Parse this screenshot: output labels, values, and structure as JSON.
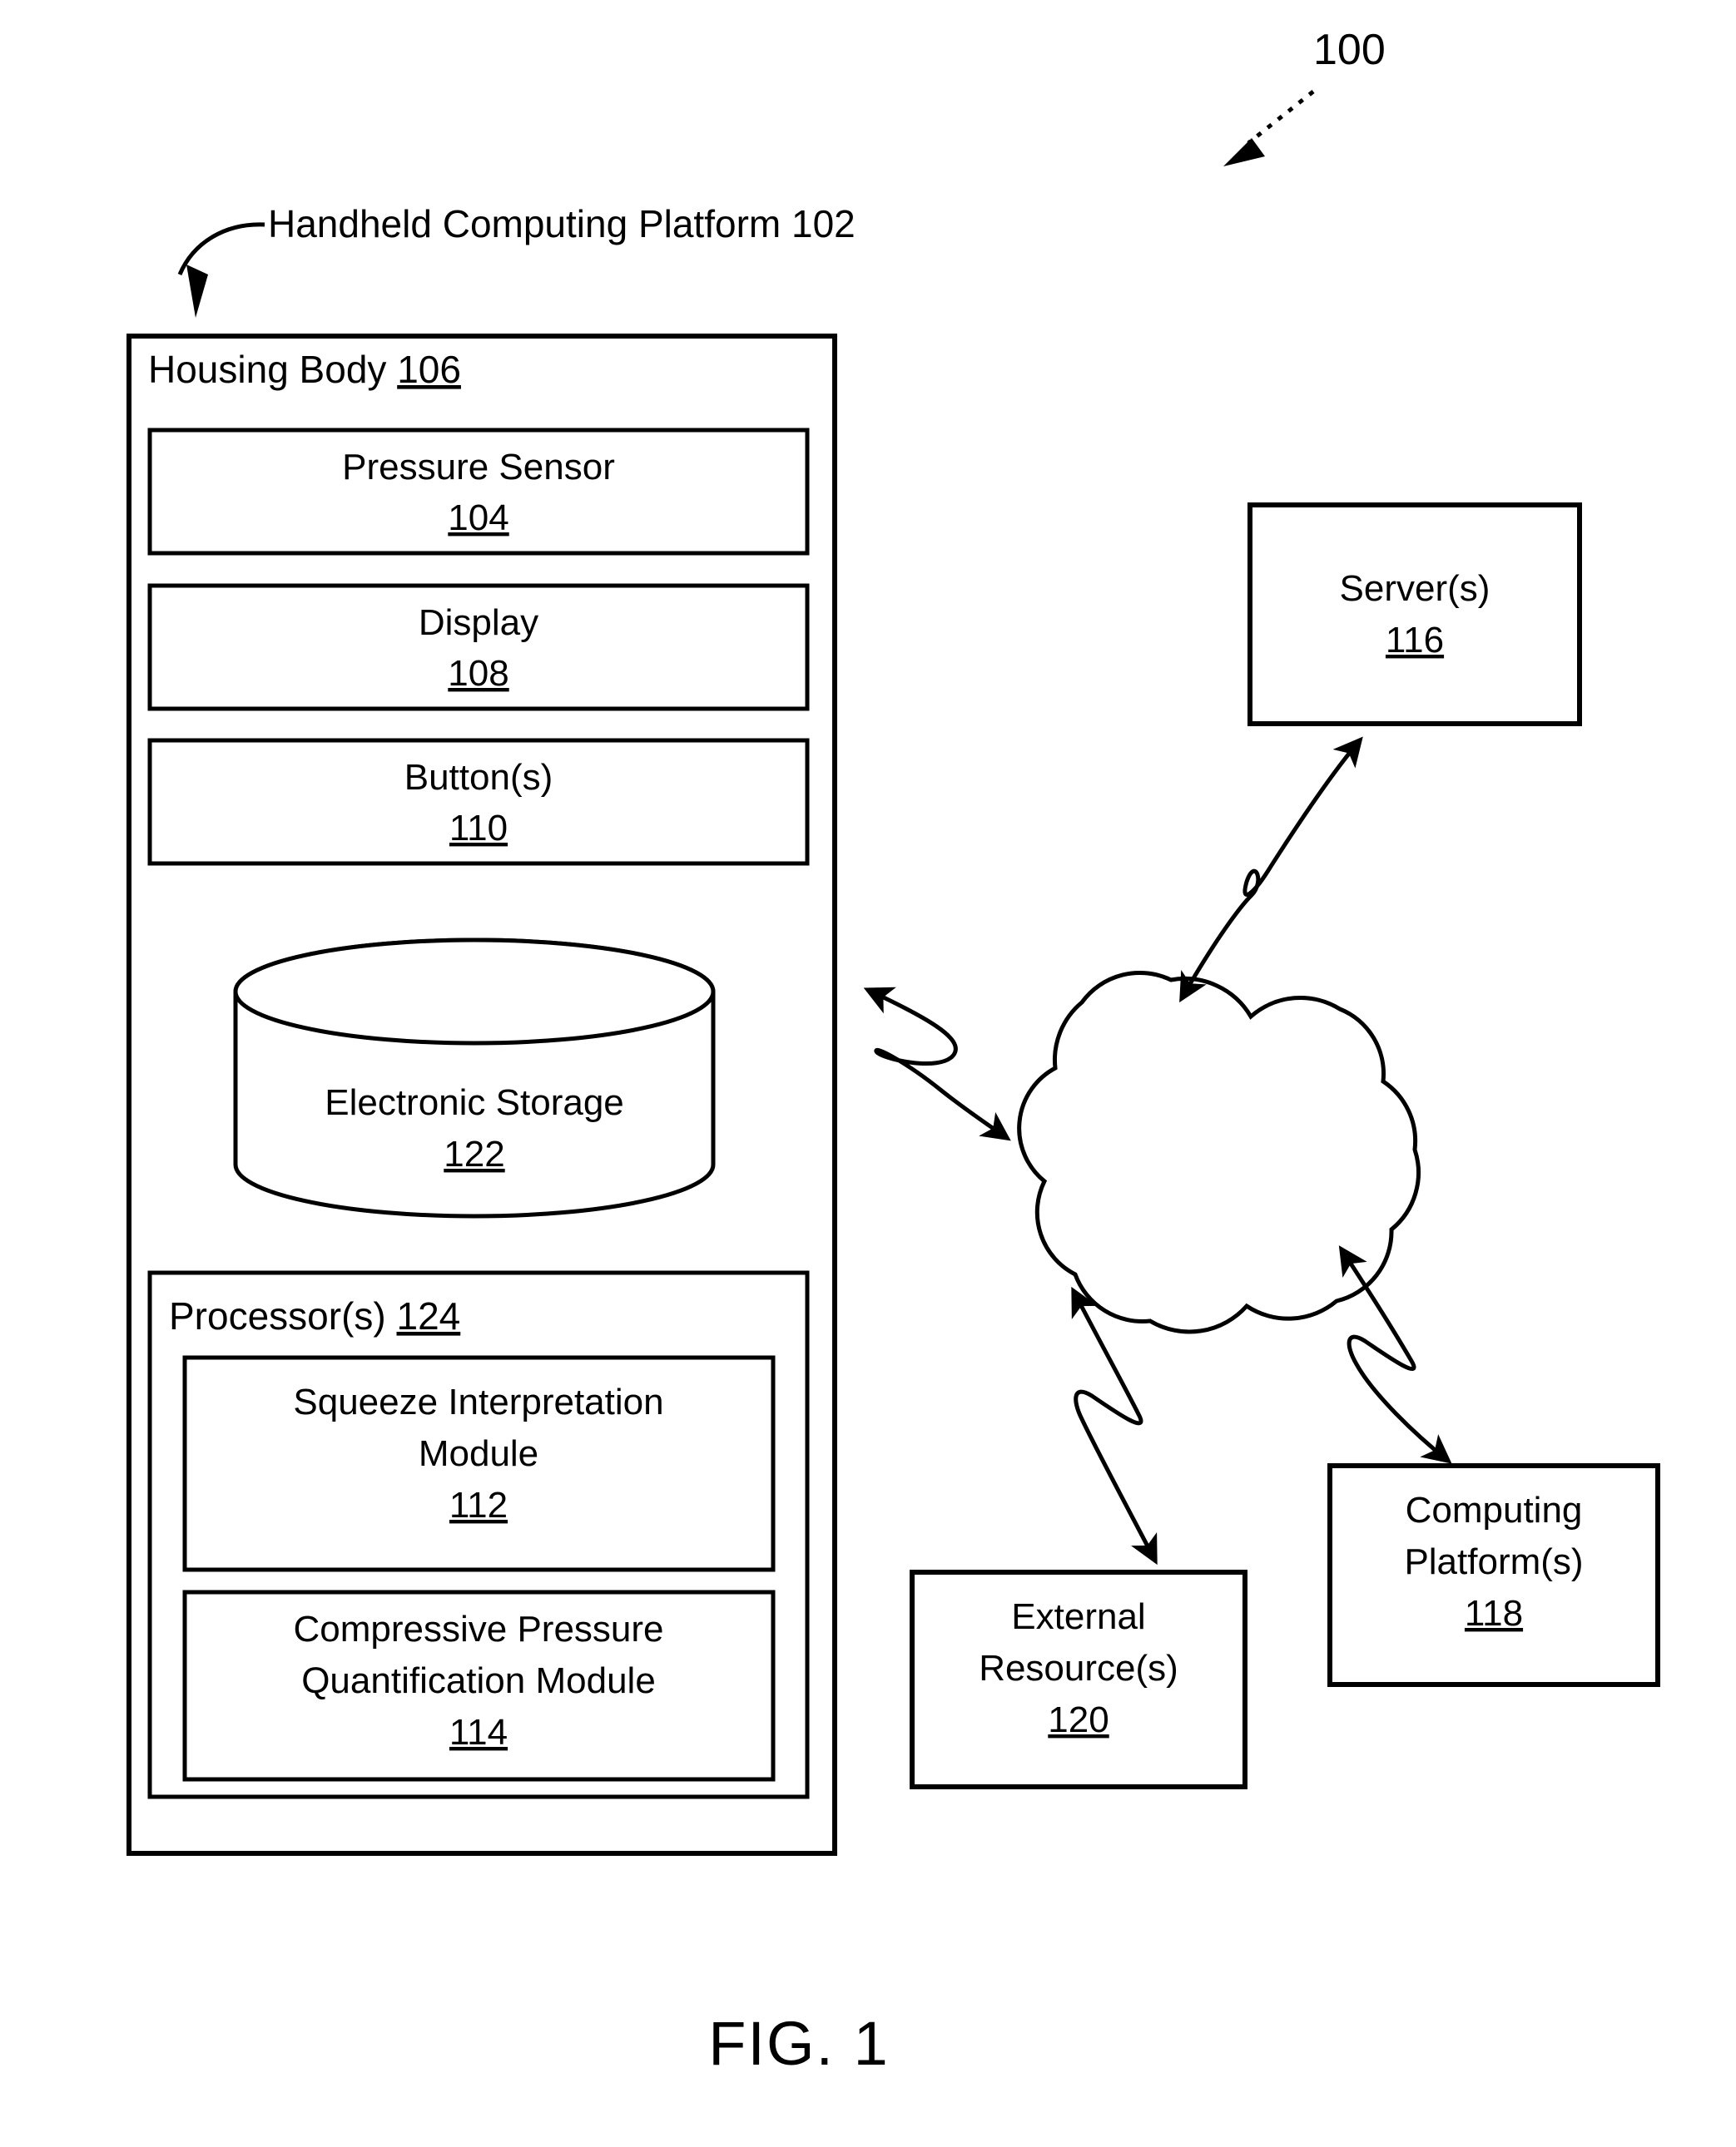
{
  "figure": {
    "caption": "FIG. 1",
    "system_reference": "100"
  },
  "callouts": {
    "handheld_platform": "Handheld Computing Platform 102"
  },
  "housing": {
    "title": "Housing Body",
    "ref": "106",
    "components": [
      {
        "name": "pressure-sensor",
        "label": "Pressure Sensor",
        "ref": "104"
      },
      {
        "name": "display",
        "label": "Display",
        "ref": "108"
      },
      {
        "name": "buttons",
        "label": "Button(s)",
        "ref": "110"
      }
    ],
    "storage": {
      "label": "Electronic Storage",
      "ref": "122"
    },
    "processors": {
      "title": "Processor(s)",
      "ref": "124",
      "modules": [
        {
          "name": "squeeze-interpretation-module",
          "line1": "Squeeze Interpretation",
          "line2": "Module",
          "ref": "112"
        },
        {
          "name": "compressive-pressure-quantification-module",
          "line1": "Compressive Pressure",
          "line2": "Quantification Module",
          "ref": "114"
        }
      ]
    }
  },
  "network": {
    "cloud_name": "network-cloud",
    "nodes": [
      {
        "name": "servers",
        "line1": "Server(s)",
        "line2": "",
        "ref": "116"
      },
      {
        "name": "computing-platforms",
        "line1": "Computing",
        "line2": "Platform(s)",
        "ref": "118"
      },
      {
        "name": "external-resources",
        "line1": "External",
        "line2": "Resource(s)",
        "ref": "120"
      }
    ]
  },
  "colors": {
    "stroke": "#000000",
    "background": "#ffffff"
  }
}
